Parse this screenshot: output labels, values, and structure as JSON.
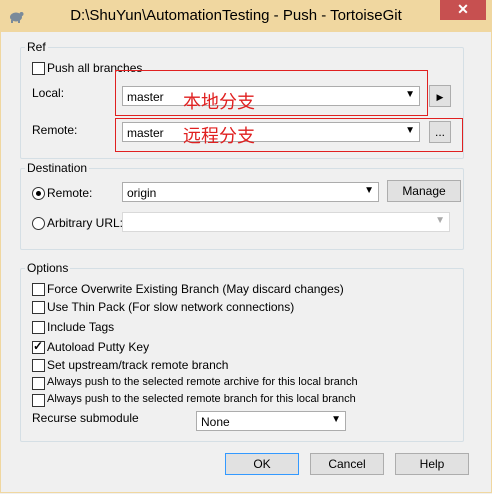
{
  "window": {
    "title": "D:\\ShuYun\\AutomationTesting - Push - TortoiseGit",
    "close": "✕"
  },
  "ref": {
    "legend": "Ref",
    "push_all": {
      "label": "Push all branches",
      "checked": false
    },
    "local": {
      "label": "Local:",
      "value": "master",
      "annotation": "本地分支",
      "go": "▶"
    },
    "remote": {
      "label": "Remote:",
      "value": "master",
      "annotation": "远程分支",
      "browse": "..."
    }
  },
  "destination": {
    "legend": "Destination",
    "remote": {
      "label": "Remote:",
      "value": "origin",
      "selected": true
    },
    "manage": "Manage",
    "arbitrary": {
      "label": "Arbitrary URL:",
      "value": ""
    }
  },
  "options": {
    "legend": "Options",
    "items": [
      {
        "label": "Force Overwrite Existing Branch (May discard changes)",
        "checked": false
      },
      {
        "label": "Use Thin Pack (For slow network connections)",
        "checked": false
      },
      {
        "label": "Include Tags",
        "checked": false
      },
      {
        "label": "Autoload Putty Key",
        "checked": true
      },
      {
        "label": "Set upstream/track remote branch",
        "checked": false
      },
      {
        "label": "Always push to the selected remote archive for this local branch",
        "checked": false
      },
      {
        "label": "Always push to the selected remote branch for this local branch",
        "checked": false
      }
    ],
    "recurse": {
      "label": "Recurse submodule",
      "value": "None"
    }
  },
  "buttons": {
    "ok": "OK",
    "cancel": "Cancel",
    "help": "Help"
  },
  "colors": {
    "titlebar": "#f0d7a0",
    "close": "#c75050",
    "annotation": "#e02020"
  }
}
